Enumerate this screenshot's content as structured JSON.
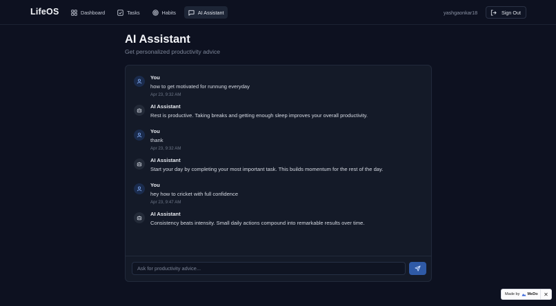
{
  "app": {
    "brand": "LifeOS"
  },
  "nav": {
    "items": [
      {
        "label": "Dashboard",
        "icon": "grid-icon",
        "active": false
      },
      {
        "label": "Tasks",
        "icon": "checkbox-icon",
        "active": false
      },
      {
        "label": "Habits",
        "icon": "target-icon",
        "active": false
      },
      {
        "label": "AI Assistant",
        "icon": "chat-icon",
        "active": true
      }
    ]
  },
  "header": {
    "username": "yashgaonkar18",
    "signout_label": "Sign Out"
  },
  "page": {
    "title": "AI Assistant",
    "subtitle": "Get personalized productivity advice"
  },
  "messages": [
    {
      "sender": "You",
      "role": "user",
      "text": "how to get motivated for runnung everyday",
      "time": "Apr 23, 9:32 AM"
    },
    {
      "sender": "AI Assistant",
      "role": "bot",
      "text": "Rest is productive. Taking breaks and getting enough sleep improves your overall productivity.",
      "time": ""
    },
    {
      "sender": "You",
      "role": "user",
      "text": "thank",
      "time": "Apr 23, 9:32 AM"
    },
    {
      "sender": "AI Assistant",
      "role": "bot",
      "text": "Start your day by completing your most important task. This builds momentum for the rest of the day.",
      "time": ""
    },
    {
      "sender": "You",
      "role": "user",
      "text": "hey how to cricket with full confidence",
      "time": "Apr 23, 9:47 AM"
    },
    {
      "sender": "AI Assistant",
      "role": "bot",
      "text": "Consistency beats intensity. Small daily actions compound into remarkable results over time.",
      "time": ""
    }
  ],
  "composer": {
    "placeholder": "Ask for productivity advice...",
    "value": ""
  },
  "badge": {
    "made_by": "Made by",
    "brand": "MeDo",
    "close": "✕"
  },
  "colors": {
    "background": "#0d1120",
    "card": "#141a28",
    "accent": "#2f5aa6",
    "user_avatar": "#1a2b4c"
  }
}
